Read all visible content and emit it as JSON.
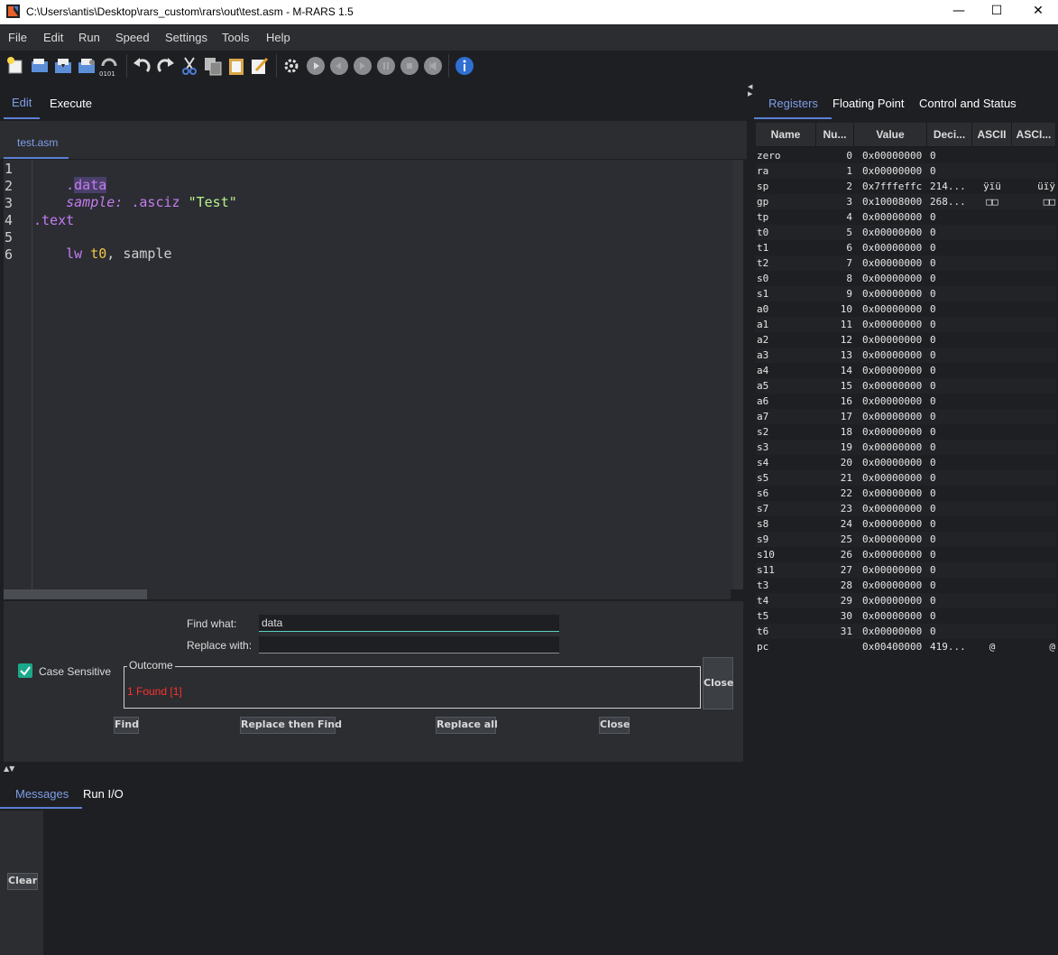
{
  "window": {
    "title": "C:\\Users\\antis\\Desktop\\rars_custom\\rars\\out\\test.asm  - M-RARS 1.5",
    "minimize": "—",
    "maximize": "☐",
    "close": "✕"
  },
  "menu": [
    "File",
    "Edit",
    "Run",
    "Speed",
    "Settings",
    "Tools",
    "Help"
  ],
  "toolbar": {
    "icons": [
      "new-file-icon",
      "open-file-icon",
      "save-icon",
      "save-as-icon",
      "dump-memory-icon",
      "undo-icon",
      "redo-icon",
      "cut-icon",
      "copy-icon",
      "paste-icon",
      "find-replace-icon",
      "assemble-icon",
      "run-icon",
      "step-back-icon",
      "step-icon",
      "pause-icon",
      "stop-icon",
      "reset-icon",
      "help-icon"
    ],
    "dump_label": "0101"
  },
  "left_tabs": {
    "edit": "Edit",
    "execute": "Execute",
    "active_file": "test.asm"
  },
  "editor": {
    "line_numbers": [
      "1",
      "2",
      "3",
      "4",
      "5",
      "6"
    ],
    "lines": {
      "l1_dot": ".",
      "l1_data": "data",
      "l2_label": "sample:",
      "l2_directive": " .asciz ",
      "l2_string": "\"Test\"",
      "l4_text": ".text",
      "l5_op": "lw ",
      "l5_reg": "t0",
      "l5_rest": ", sample"
    }
  },
  "find_replace": {
    "find_label": "Find what:",
    "find_value": "data",
    "replace_label": "Replace with:",
    "replace_value": "",
    "case_sensitive_label": "Case Sensitive",
    "case_sensitive_checked": true,
    "outcome_title": "Outcome",
    "outcome_text": "1 Found [1]",
    "close_side": "Close",
    "buttons": {
      "find": "Find",
      "replace_then_find": "Replace then Find",
      "replace_all": "Replace all",
      "close": "Close"
    }
  },
  "messages": {
    "tab_messages": "Messages",
    "tab_run_io": "Run I/O",
    "clear": "Clear"
  },
  "right_tabs": {
    "registers": "Registers",
    "floating_point": "Floating Point",
    "control_status": "Control and Status"
  },
  "registers": {
    "columns": [
      "Name",
      "Nu...",
      "Value",
      "Deci...",
      "ASCII",
      "ASCI..."
    ],
    "rows": [
      [
        "zero",
        "0",
        "0x00000000",
        "0",
        "",
        ""
      ],
      [
        "ra",
        "1",
        "0x00000000",
        "0",
        "",
        ""
      ],
      [
        "sp",
        "2",
        "0x7fffeffc",
        "214...",
        "ÿïü",
        "üïÿ"
      ],
      [
        "gp",
        "3",
        "0x10008000",
        "268...",
        "□□",
        "□□"
      ],
      [
        "tp",
        "4",
        "0x00000000",
        "0",
        "",
        ""
      ],
      [
        "t0",
        "5",
        "0x00000000",
        "0",
        "",
        ""
      ],
      [
        "t1",
        "6",
        "0x00000000",
        "0",
        "",
        ""
      ],
      [
        "t2",
        "7",
        "0x00000000",
        "0",
        "",
        ""
      ],
      [
        "s0",
        "8",
        "0x00000000",
        "0",
        "",
        ""
      ],
      [
        "s1",
        "9",
        "0x00000000",
        "0",
        "",
        ""
      ],
      [
        "a0",
        "10",
        "0x00000000",
        "0",
        "",
        ""
      ],
      [
        "a1",
        "11",
        "0x00000000",
        "0",
        "",
        ""
      ],
      [
        "a2",
        "12",
        "0x00000000",
        "0",
        "",
        ""
      ],
      [
        "a3",
        "13",
        "0x00000000",
        "0",
        "",
        ""
      ],
      [
        "a4",
        "14",
        "0x00000000",
        "0",
        "",
        ""
      ],
      [
        "a5",
        "15",
        "0x00000000",
        "0",
        "",
        ""
      ],
      [
        "a6",
        "16",
        "0x00000000",
        "0",
        "",
        ""
      ],
      [
        "a7",
        "17",
        "0x00000000",
        "0",
        "",
        ""
      ],
      [
        "s2",
        "18",
        "0x00000000",
        "0",
        "",
        ""
      ],
      [
        "s3",
        "19",
        "0x00000000",
        "0",
        "",
        ""
      ],
      [
        "s4",
        "20",
        "0x00000000",
        "0",
        "",
        ""
      ],
      [
        "s5",
        "21",
        "0x00000000",
        "0",
        "",
        ""
      ],
      [
        "s6",
        "22",
        "0x00000000",
        "0",
        "",
        ""
      ],
      [
        "s7",
        "23",
        "0x00000000",
        "0",
        "",
        ""
      ],
      [
        "s8",
        "24",
        "0x00000000",
        "0",
        "",
        ""
      ],
      [
        "s9",
        "25",
        "0x00000000",
        "0",
        "",
        ""
      ],
      [
        "s10",
        "26",
        "0x00000000",
        "0",
        "",
        ""
      ],
      [
        "s11",
        "27",
        "0x00000000",
        "0",
        "",
        ""
      ],
      [
        "t3",
        "28",
        "0x00000000",
        "0",
        "",
        ""
      ],
      [
        "t4",
        "29",
        "0x00000000",
        "0",
        "",
        ""
      ],
      [
        "t5",
        "30",
        "0x00000000",
        "0",
        "",
        ""
      ],
      [
        "t6",
        "31",
        "0x00000000",
        "0",
        "",
        ""
      ],
      [
        "pc",
        "",
        "0x00400000",
        "419...",
        "@",
        "@"
      ]
    ]
  },
  "colors": {
    "accent": "#5b7fd6",
    "keyword_purple": "#c57cf0",
    "string_green": "#b8f08a",
    "register_yellow": "#f5c542",
    "outcome_red": "#ff3030"
  }
}
